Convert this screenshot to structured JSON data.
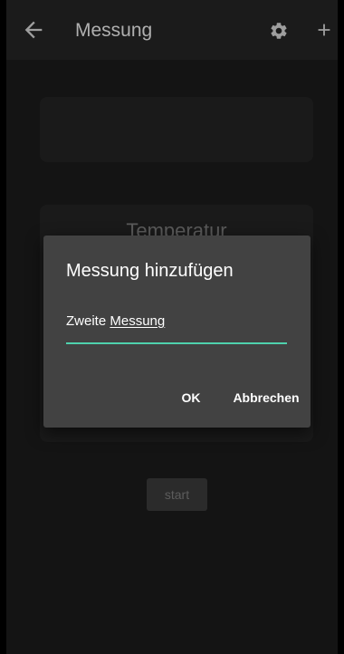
{
  "header": {
    "title": "Messung",
    "back_icon": "back-arrow-icon",
    "settings_icon": "gear-icon",
    "add_icon": "plus-icon"
  },
  "cards": {
    "measurement_title": "Temperatur"
  },
  "start_button": {
    "label": "start"
  },
  "dialog": {
    "title": "Messung hinzufügen",
    "input_prefix": "Zweite ",
    "input_underlined": "Messung",
    "ok_label": "OK",
    "cancel_label": "Abbrechen",
    "accent_color": "#4fd1ad"
  },
  "colors": {
    "background": "#141414",
    "toolbar": "#1b1b1b",
    "dialog": "#424242"
  }
}
